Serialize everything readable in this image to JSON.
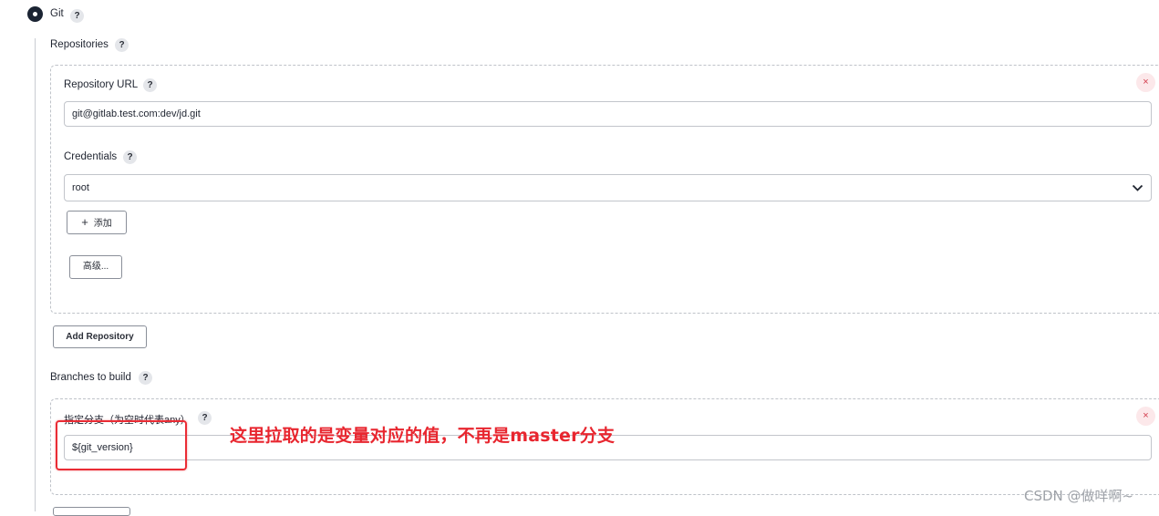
{
  "scm": {
    "git_label": "Git",
    "help": "?"
  },
  "repositories": {
    "label": "Repositories",
    "repository_url": {
      "label": "Repository URL",
      "value": "git@gitlab.test.com:dev/jd.git"
    },
    "credentials": {
      "label": "Credentials",
      "value": "root"
    },
    "add_button": "添加",
    "advanced_button": "高级...",
    "add_repository_button": "Add Repository",
    "remove_symbol": "×"
  },
  "branches": {
    "label": "Branches to build",
    "specifier_label": "指定分支（为空时代表any）",
    "specifier_value": "${git_version}",
    "remove_symbol": "×"
  },
  "annotation": {
    "text": "这里拉取的是变量对应的值，不再是master分支",
    "color": "#e8262f"
  },
  "watermark": "CSDN @做咩啊~",
  "colors": {
    "accent": "#1b2433",
    "annotation_red": "#ea2c35"
  }
}
